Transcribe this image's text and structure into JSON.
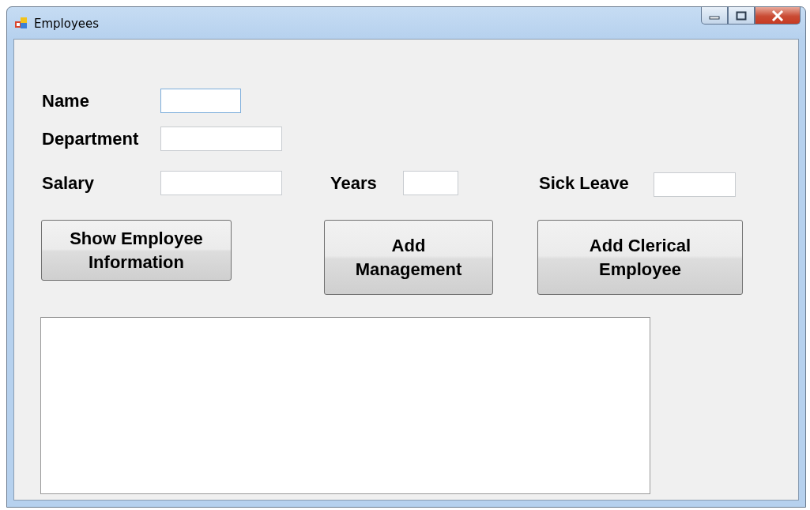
{
  "window": {
    "title": "Employees"
  },
  "fields": [
    {
      "label": "Name",
      "focused": true
    },
    {
      "label": "Department",
      "focused": false
    },
    {
      "label": "Salary",
      "focused": false
    },
    {
      "label": "Years",
      "focused": false
    },
    {
      "label": "Sick Leave",
      "focused": false
    }
  ],
  "buttons": [
    {
      "lines": [
        "Show Employee",
        "Information"
      ]
    },
    {
      "lines": [
        "Add",
        "Management"
      ]
    },
    {
      "lines": [
        "Add Clerical",
        "Employee"
      ]
    }
  ]
}
